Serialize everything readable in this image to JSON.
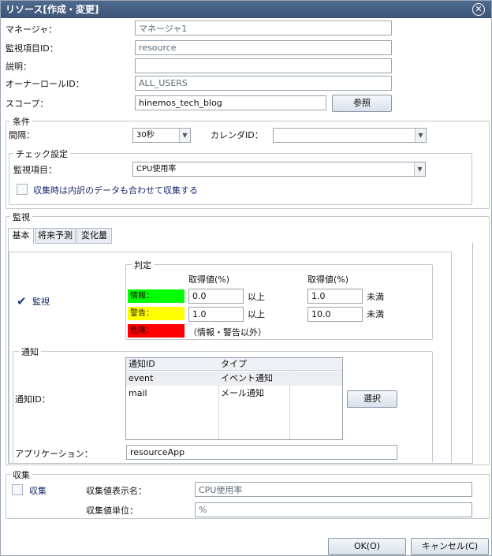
{
  "window": {
    "title": "リソース[作成・変更]",
    "close_icon": "close-icon"
  },
  "fields": {
    "manager": {
      "label": "マネージャ：",
      "value": "マネージャ1"
    },
    "monitor_id": {
      "label": "監視項目ID：",
      "value": "resource"
    },
    "description": {
      "label": "説明：",
      "value": ""
    },
    "owner_role": {
      "label": "オーナーロールID：",
      "value": "ALL_USERS"
    },
    "scope": {
      "label": "スコープ：",
      "value": "hinemos_tech_blog",
      "button": "参照"
    }
  },
  "condition": {
    "title": "条件",
    "interval_label": "間隔：",
    "interval_value": "30秒",
    "calendar_label": "カレンダID：",
    "calendar_value": "",
    "check": {
      "title": "チェック設定",
      "item_label": "監視項目：",
      "item_value": "CPU使用率",
      "breakdown_label": "収集時は内訳のデータも合わせて収集する",
      "breakdown_checked": false
    }
  },
  "monitor": {
    "title": "監視",
    "tabs": [
      "基本",
      "将来予測",
      "変化量"
    ],
    "active_tab": "基本",
    "enable_label": "監視",
    "enable_checked": true,
    "judge": {
      "title": "判定",
      "col_header_1": "取得値(%)",
      "col_header_2": "取得値(%)",
      "rows": [
        {
          "label": "情報：",
          "color": "#00ff00",
          "from": "0.0",
          "from_unit": "以上",
          "to": "1.0",
          "to_unit": "未満"
        },
        {
          "label": "警告：",
          "color": "#ffff00",
          "from": "1.0",
          "from_unit": "以上",
          "to": "10.0",
          "to_unit": "未満"
        },
        {
          "label": "危険：",
          "color": "#ff0000",
          "note": "（情報・警告以外）"
        }
      ]
    },
    "notify": {
      "title": "通知",
      "id_label": "通知ID：",
      "headers": [
        "通知ID",
        "タイプ"
      ],
      "rows": [
        {
          "id": "event",
          "type": "イベント通知"
        },
        {
          "id": "mail",
          "type": "メール通知"
        }
      ],
      "select_button": "選択",
      "app_label": "アプリケーション：",
      "app_value": "resourceApp"
    }
  },
  "collect": {
    "title": "収集",
    "enable_label": "収集",
    "enable_checked": false,
    "display_name_label": "収集値表示名：",
    "display_name_value": "CPU使用率",
    "unit_label": "収集値単位：",
    "unit_value": "%"
  },
  "footer": {
    "ok": "OK(O)",
    "cancel": "キャンセル(C)"
  }
}
